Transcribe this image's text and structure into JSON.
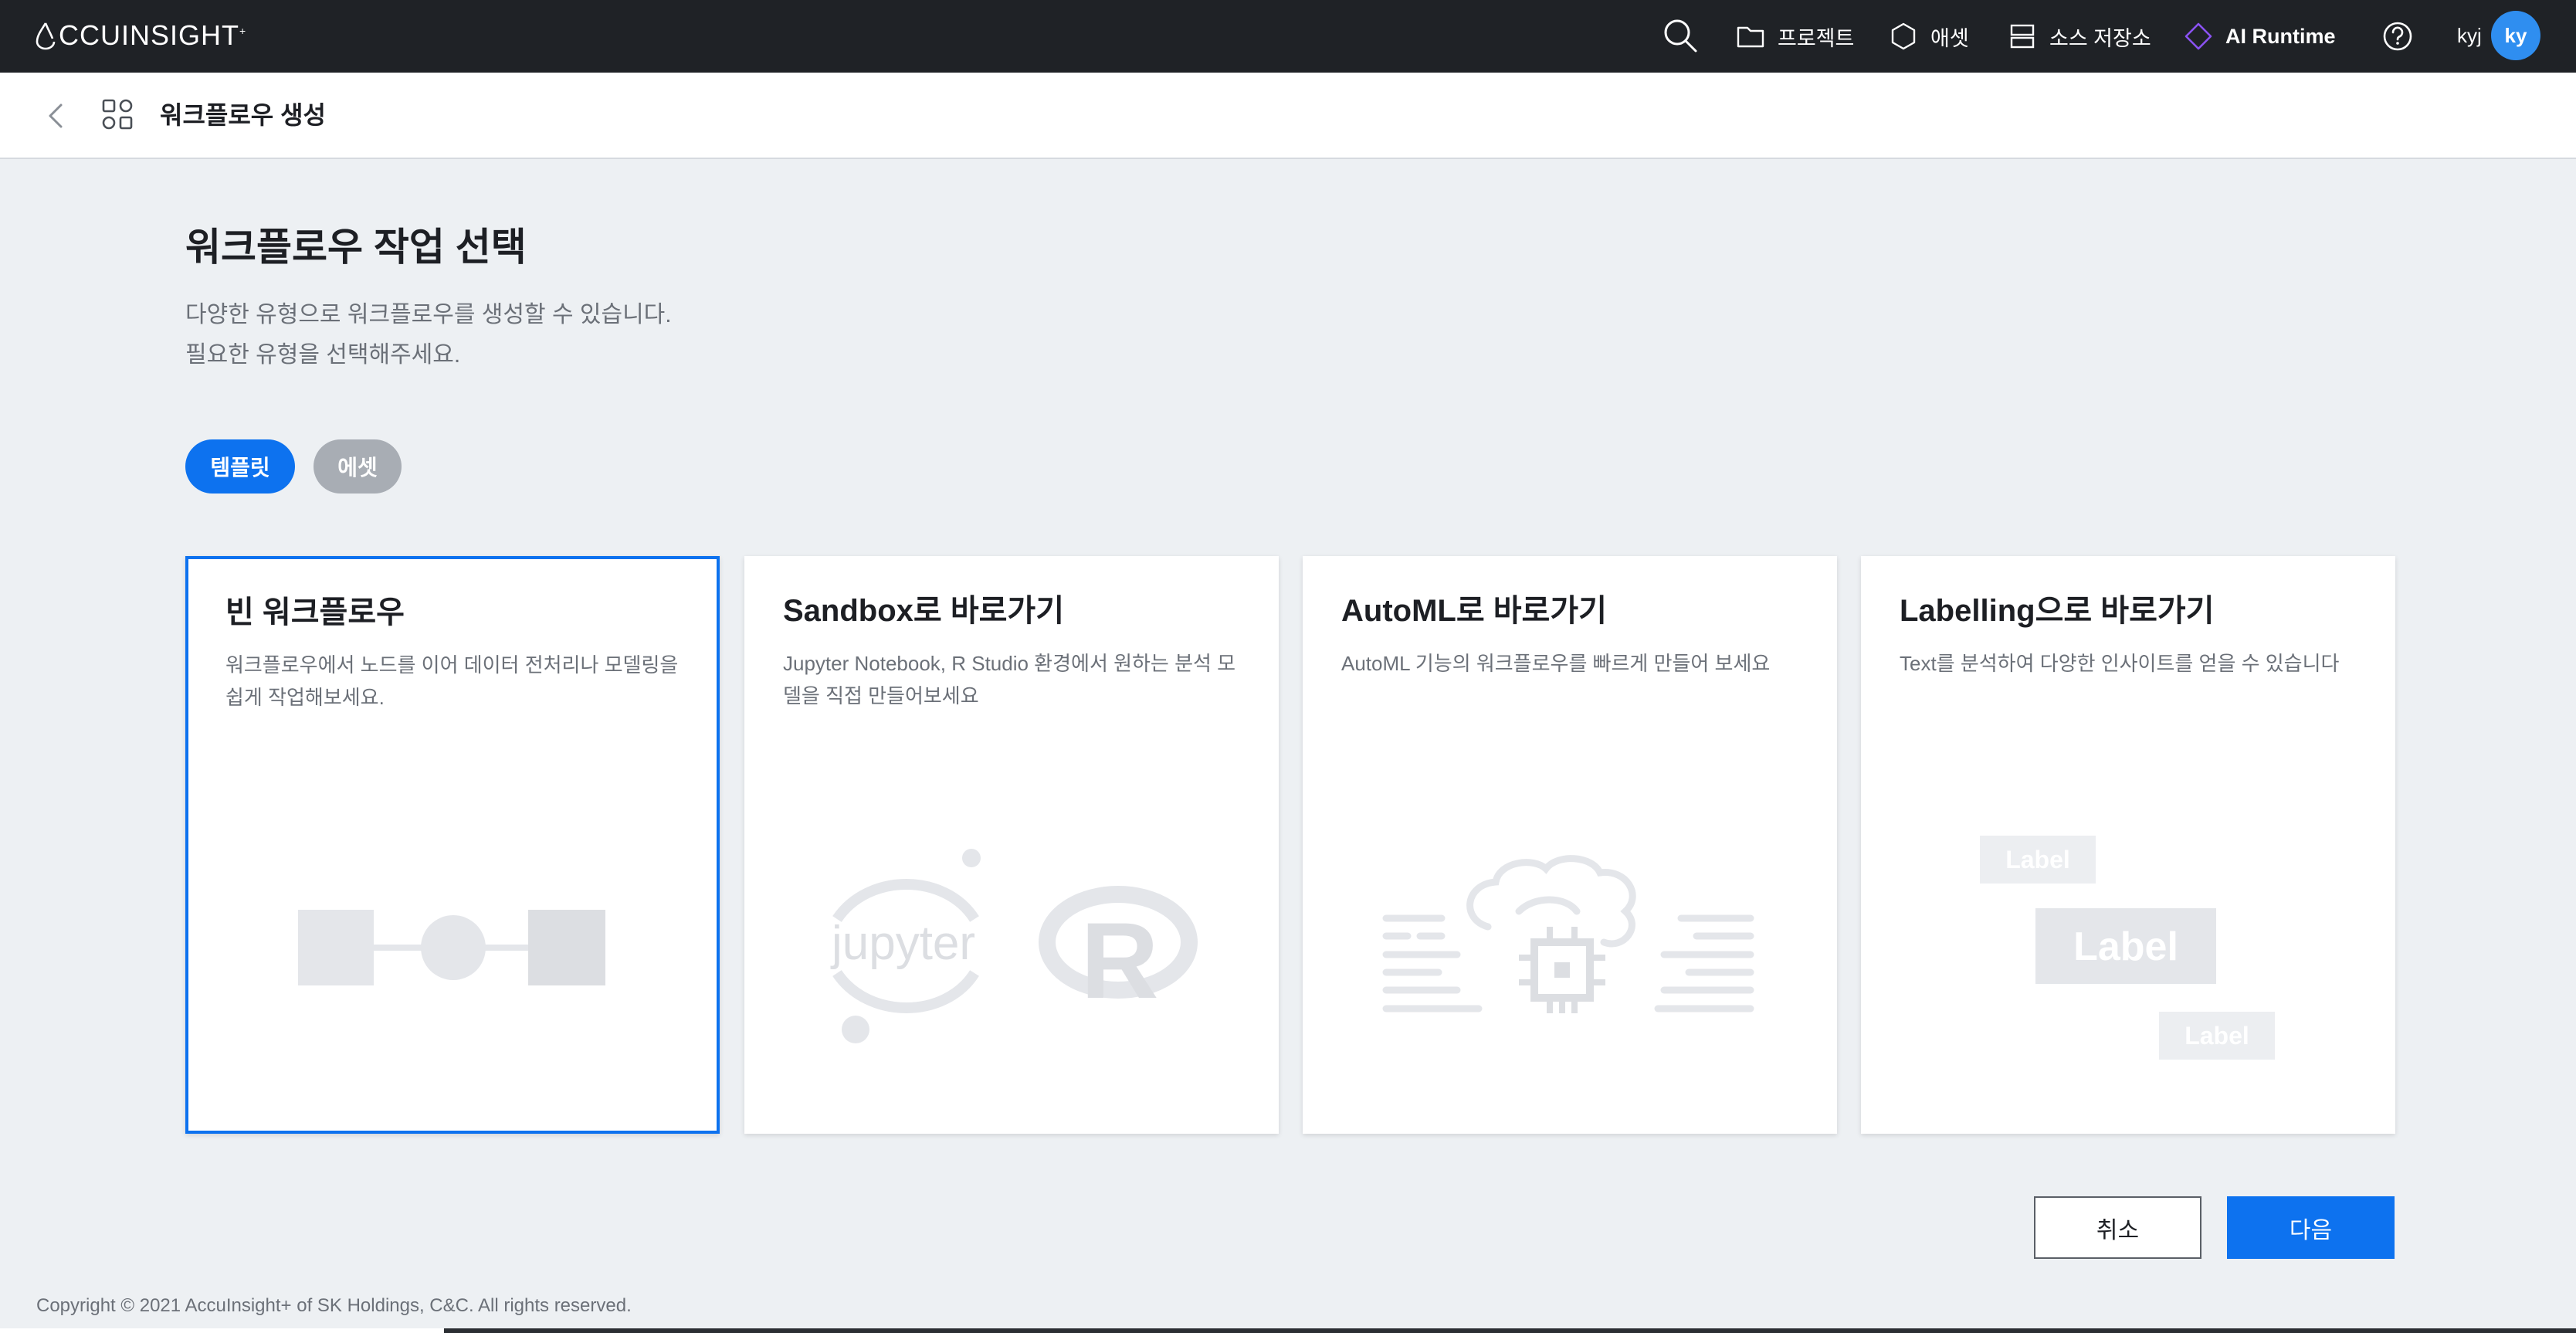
{
  "app": {
    "logo_text": "CCUINSIGHT",
    "logo_mark": "A",
    "logo_sup": "+"
  },
  "nav": {
    "projects": "프로젝트",
    "assets": "애셋",
    "source_repo": "소스 저장소",
    "ai_runtime": "AI Runtime",
    "user_name": "kyj",
    "avatar": "ky"
  },
  "subheader": {
    "title": "워크플로우 생성"
  },
  "page": {
    "title": "워크플로우 작업 선택",
    "desc_line1": "다양한 유형으로 워크플로우를 생성할 수 있습니다.",
    "desc_line2": "필요한 유형을 선택해주세요."
  },
  "tabs": {
    "template": "템플릿",
    "asset": "에셋"
  },
  "cards": [
    {
      "title": "빈 워크플로우",
      "desc": "워크플로우에서 노드를 이어 데이터 전처리나 모델링을 쉽게 작업해보세요.",
      "selected": true
    },
    {
      "title": "Sandbox로 바로가기",
      "desc": "Jupyter Notebook, R Studio 환경에서 원하는 분석 모델을 직접 만들어보세요",
      "illus_text": "jupyter",
      "illus_text2": "R"
    },
    {
      "title": "AutoML로 바로가기",
      "desc": "AutoML 기능의 워크플로우를 빠르게 만들어 보세요"
    },
    {
      "title": "Labelling으로 바로가기",
      "desc": "Text를 분석하여 다양한 인사이트를 얻을 수 있습니다",
      "labels": [
        "Label",
        "Label",
        "Label"
      ]
    }
  ],
  "actions": {
    "cancel": "취소",
    "next": "다음"
  },
  "footer": {
    "copyright": "Copyright © 2021 AccuInsight+ of SK Holdings, C&C. All rights reserved."
  },
  "colors": {
    "primary": "#0d72ef",
    "topbar": "#1f2226",
    "background": "#edf0f3",
    "ai_runtime_icon": "#8a52f2"
  }
}
